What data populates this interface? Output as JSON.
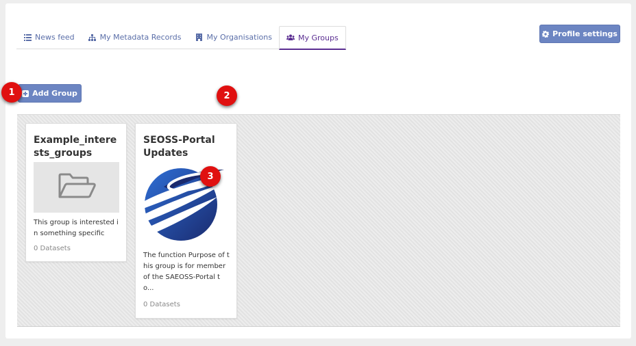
{
  "tabs": [
    {
      "label": "News feed",
      "icon": "list-icon"
    },
    {
      "label": "My Metadata Records",
      "icon": "sitemap-icon"
    },
    {
      "label": "My Organisations",
      "icon": "building-icon"
    },
    {
      "label": "My Groups",
      "icon": "users-icon",
      "active": true
    }
  ],
  "profile_button": {
    "label": "Profile settings",
    "icon": "gear-icon"
  },
  "add_group_button": {
    "label": "Add Group",
    "icon": "plus-square-icon"
  },
  "badges": [
    "1",
    "2",
    "3"
  ],
  "groups": [
    {
      "title": "Example_interests_groups",
      "image": "folder-open-icon",
      "description": "This group is interested in something specific",
      "datasets": "0 Datasets"
    },
    {
      "title": "SEOSS-Portal Updates",
      "image": "globe-swoosh-logo",
      "description": "The function Purpose of this group is for member of the SAEOSS-Portal to...",
      "datasets": "0 Datasets"
    }
  ],
  "colors": {
    "accent": "#6c85c2",
    "active_tab": "#5a2d91",
    "link": "#5a6ea8",
    "badge": "#e01010"
  }
}
